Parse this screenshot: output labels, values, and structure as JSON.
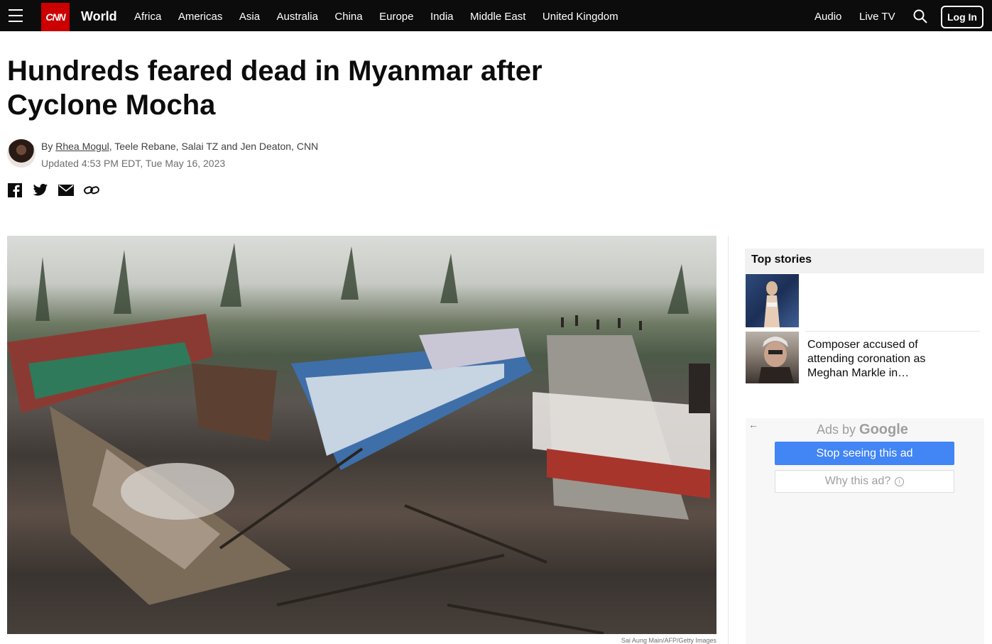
{
  "nav": {
    "logo_text": "CNN",
    "section": "World",
    "links": [
      "Africa",
      "Americas",
      "Asia",
      "Australia",
      "China",
      "Europe",
      "India",
      "Middle East",
      "United Kingdom"
    ],
    "audio": "Audio",
    "live_tv": "Live TV",
    "login": "Log In"
  },
  "article": {
    "headline": "Hundreds feared dead in Myanmar after Cyclone Mocha",
    "byline_prefix": "By ",
    "byline_author": "Rhea Mogul",
    "byline_rest": ", Teele Rebane, Salai TZ and Jen Deaton, CNN",
    "timestamp": "Updated 4:53 PM EDT, Tue May 16, 2023",
    "image_caption": "Sai Aung Main/AFP/Getty Images"
  },
  "sidebar": {
    "top_stories_label": "Top stories",
    "story2_title": "Composer accused of attending coronation as Meghan Markle in…"
  },
  "ad": {
    "back_arrow": "←",
    "ads_by": "Ads by ",
    "google": "Google",
    "stop_label": "Stop seeing this ad",
    "why_label": "Why this ad?",
    "info_glyph": "i"
  },
  "colors": {
    "nav_bg": "#0c0c0c",
    "brand_red": "#cc0000",
    "ad_button_blue": "#4285f4"
  }
}
